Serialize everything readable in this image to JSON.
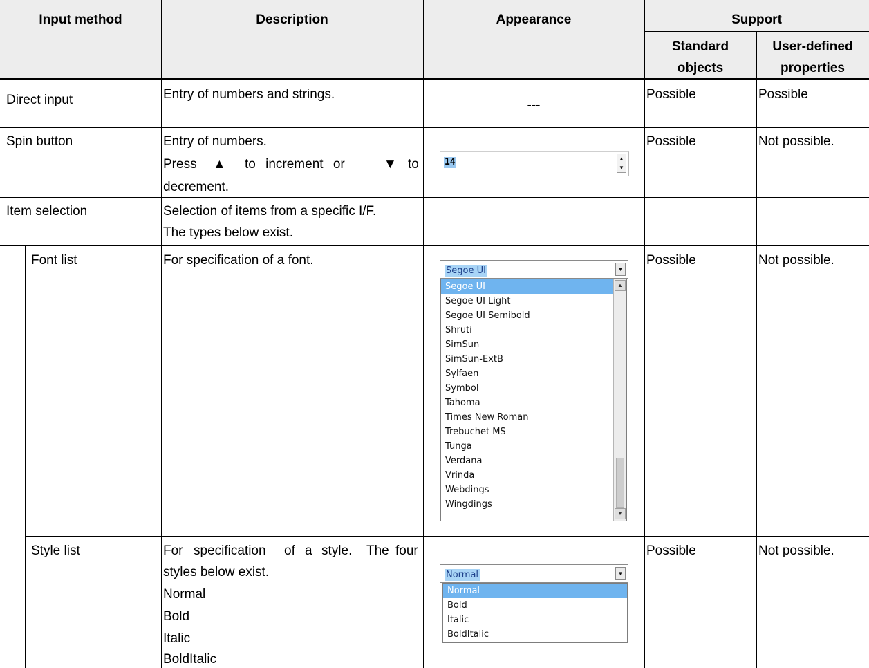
{
  "header": {
    "input_method": "Input method",
    "description": "Description",
    "appearance": "Appearance",
    "support": "Support",
    "standard_line1": "Standard",
    "standard_line2": "objects",
    "user_line1": "User-defined",
    "user_line2": "properties"
  },
  "rows": {
    "direct": {
      "method": "Direct input",
      "desc": "Entry of numbers and strings.",
      "appearance": "---",
      "standard": "Possible",
      "user": "Possible"
    },
    "spin": {
      "method": "Spin button",
      "desc1": "Entry of numbers.",
      "desc2_press": "Press",
      "desc2_up": "▲",
      "desc2_mid": "to increment or",
      "desc2_down": "▼",
      "desc2_to": "to",
      "desc3": "decrement.",
      "value": "14",
      "standard": "Possible",
      "user": "Not possible."
    },
    "item": {
      "method": "Item selection",
      "desc1": "Selection of items from a specific I/F.",
      "desc2": "The types below exist."
    },
    "font": {
      "method": "Font list",
      "desc": "For specification of a font.",
      "selected": "Segoe UI",
      "options": [
        "Segoe UI",
        "Segoe UI Light",
        "Segoe UI Semibold",
        "Shruti",
        "SimSun",
        "SimSun-ExtB",
        "Sylfaen",
        "Symbol",
        "Tahoma",
        "Times New Roman",
        "Trebuchet MS",
        "Tunga",
        "Verdana",
        "Vrinda",
        "Webdings",
        "Wingdings"
      ],
      "standard": "Possible",
      "user": "Not possible."
    },
    "style": {
      "method": "Style list",
      "desc1a": "For",
      "desc1b": "specification",
      "desc1c": "of",
      "desc1d": "a",
      "desc1e": "style.",
      "desc1f": "The",
      "desc1g": "four",
      "desc2": "styles below exist.",
      "items": [
        "Normal",
        "Bold",
        "Italic",
        "BoldItalic"
      ],
      "selected": "Normal",
      "options": [
        "Normal",
        "Bold",
        "Italic",
        "BoldItalic"
      ],
      "standard": "Possible",
      "user": "Not possible."
    }
  },
  "icons": {
    "dropdown": "chevron-down-icon",
    "spin_up": "arrow-up-icon",
    "spin_down": "arrow-down-icon"
  },
  "colors": {
    "header_bg": "#ededed",
    "selection": "#6fb4ef",
    "border": "#000000"
  }
}
